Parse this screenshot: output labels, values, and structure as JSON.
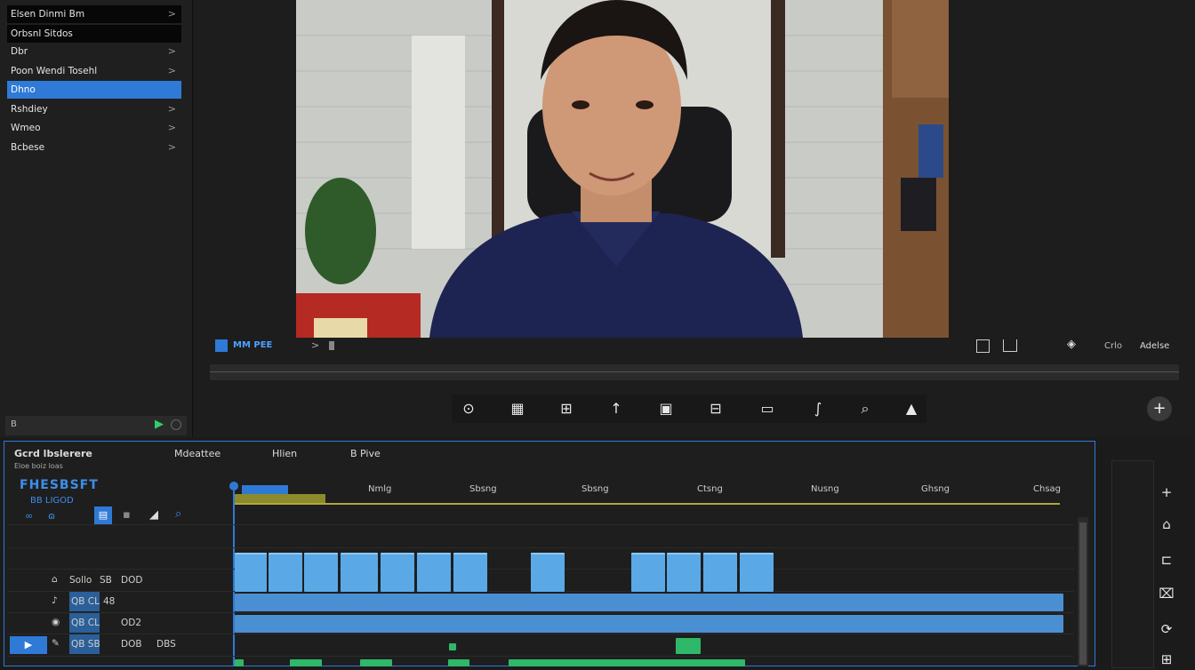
{
  "sidebar": {
    "items": [
      {
        "label": "Elsen Dinmi Bm",
        "state": "dark"
      },
      {
        "label": "Orbsnl Sitdos",
        "state": "dark"
      },
      {
        "label": "Dbr",
        "state": "normal"
      },
      {
        "label": "Poon Wendi Tosehl",
        "state": "normal"
      },
      {
        "label": "Dhno",
        "state": "selected"
      },
      {
        "label": "Rshdiey",
        "state": "normal"
      },
      {
        "label": "Wmeo",
        "state": "normal"
      },
      {
        "label": "Bcbese",
        "state": "normal"
      }
    ],
    "footer_label": "B"
  },
  "viewer": {
    "timecode_label": "MM PEE",
    "right_label": "Crlo",
    "right_label2": "Adelse"
  },
  "toolbar": {
    "icons": [
      "pin-icon",
      "grid-icon",
      "cart-icon",
      "arrow-up-icon",
      "frame-icon",
      "split-icon",
      "caption-icon",
      "curve-icon",
      "zoom-icon",
      "mask-icon"
    ]
  },
  "timeline": {
    "tabs": [
      "Gcrd lbslerere",
      "Mdeattee",
      "Hlien",
      "B Pive"
    ],
    "subtitle": "Eloe boiz loas",
    "big_time": "FHESBSFT",
    "small_time": "BB  LIGOD",
    "ruler_labels": [
      "Nmlg",
      "Sbsng",
      "Sbsng",
      "Ctsng",
      "Nusng",
      "Ghsng",
      "Chsag"
    ],
    "tracks": [
      {
        "name": "Sollo",
        "c1": "SB",
        "c2": "DOD"
      },
      {
        "name": "",
        "c1": "QB  CL",
        "c2": "48"
      },
      {
        "name": "",
        "c1": "QB  CL",
        "c2": "OD2"
      },
      {
        "name": "",
        "c1": "QB  SB",
        "c2": "DOB"
      }
    ],
    "track4_extra": "DBS"
  },
  "colors": {
    "accent": "#2f7ad6",
    "video_clip": "#5aa9e6",
    "audio_clip": "#4b8fd3",
    "green_clip": "#2fb86a",
    "playhead": "#2f7ad6"
  }
}
